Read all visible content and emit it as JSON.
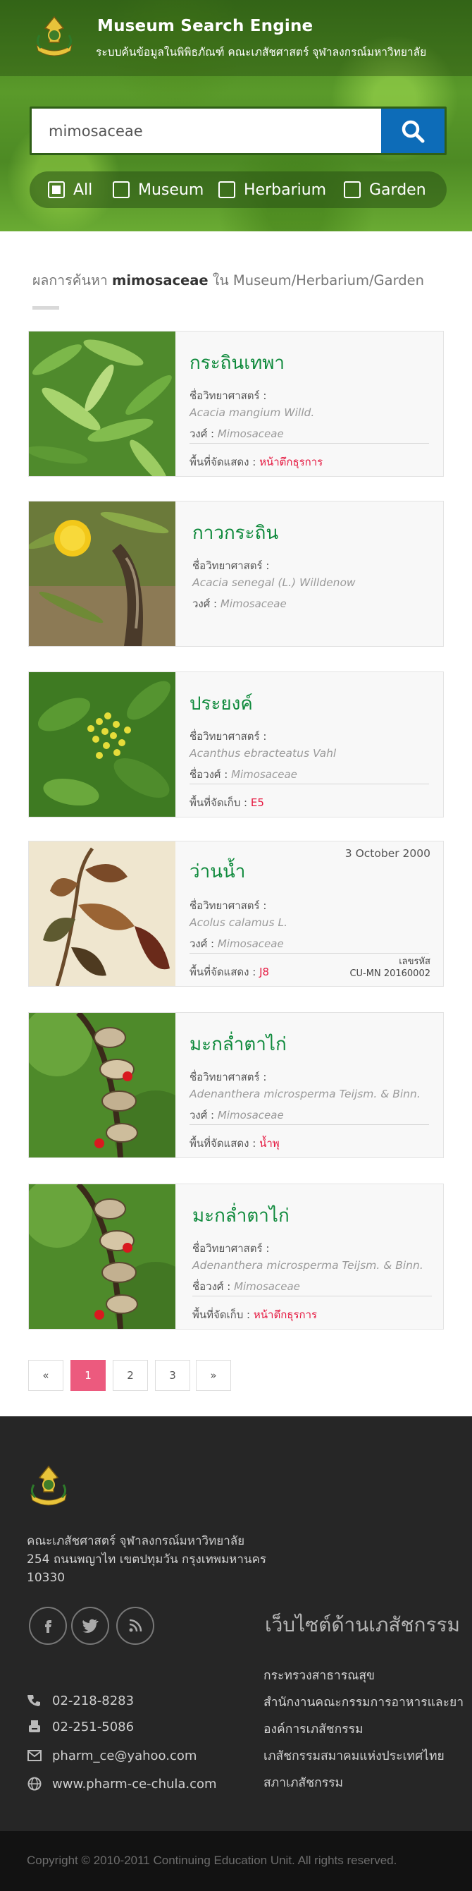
{
  "header": {
    "title": "Museum Search Engine",
    "subtitle": "ระบบค้นข้อมูลในพิพิธภัณฑ์ คณะเภสัชศาสตร์ จุฬาลงกรณ์มหาวิทยาลัย"
  },
  "search": {
    "value": "mimosaceae",
    "button_icon": "search-icon"
  },
  "filters": [
    {
      "label": "All",
      "checked": true
    },
    {
      "label": "Museum",
      "checked": false
    },
    {
      "label": "Herbarium",
      "checked": false
    },
    {
      "label": "Garden",
      "checked": false
    }
  ],
  "results_heading": {
    "prefix": "ผลการค้นหา",
    "term": "mimosaceae",
    "suffix": "ใน Museum/Herbarium/Garden"
  },
  "results": [
    {
      "name": "กระถินเทพา",
      "sci_label": "ชื่อวิทยาศาสตร์ :",
      "sci_name": "Acacia mangium Willd.",
      "family_label": "วงศ์ :",
      "family": "Mimosaceae",
      "loc_label": "พื้นที่จัดแสดง :",
      "loc": "หน้าตึกธุรการ"
    },
    {
      "name": "กาวกระถิน",
      "sci_label": "ชื่อวิทยาศาสตร์ :",
      "sci_name": "Acacia senegal  (L.) Willdenow",
      "family_label": "วงศ์ :",
      "family": "Mimosaceae"
    },
    {
      "name": "ประยงค์",
      "sci_label": "ชื่อวิทยาศาสตร์ :",
      "sci_name": "Acanthus ebracteatus Vahl",
      "family_label": "ชื่อวงศ์ :",
      "family": "Mimosaceae",
      "loc_label": "พื้นที่จัดเก็บ :",
      "loc": "E5"
    },
    {
      "name": "ว่านน้ำ",
      "date": "3 October  2000",
      "sci_label": "ชื่อวิทยาศาสตร์ :",
      "sci_name": "Acolus calamus L.",
      "family_label": "วงศ์ :",
      "family": "Mimosaceae",
      "loc_label": "พื้นที่จัดแสดง :",
      "loc": "J8",
      "code_label": "เลขรหัส",
      "code": "CU-MN 20160002"
    },
    {
      "name": "มะกล่ำตาไก่",
      "sci_label": "ชื่อวิทยาศาสตร์ :",
      "sci_name": "Adenanthera microsperma Teijsm. & Binn.",
      "family_label": "วงศ์ :",
      "family": "Mimosaceae",
      "loc_label": "พื้นที่จัดแสดง :",
      "loc": "น้ำพุ"
    },
    {
      "name": "มะกล่ำตาไก่",
      "sci_label": "ชื่อวิทยาศาสตร์ :",
      "sci_name": "Adenanthera microsperma Teijsm. & Binn.",
      "family_label": "ชื่อวงศ์ :",
      "family": "Mimosaceae",
      "loc_label": "พื้นที่จัดเก็บ :",
      "loc": "หน้าตึกธุรการ"
    }
  ],
  "pagination": {
    "prev": "«",
    "pages": [
      "1",
      "2",
      "3"
    ],
    "active": "1",
    "next": "»"
  },
  "footer": {
    "address_lines": [
      "คณะเภสัชศาสตร์ จุฬาลงกรณ์มหาวิทยาลัย",
      "254 ถนนพญาไท เขตปทุมวัน กรุงเทพมหานคร",
      "10330"
    ],
    "social": [
      "facebook-icon",
      "twitter-icon",
      "rss-icon"
    ],
    "links_heading": "เว็บไซต์ด้านเภสัชกรรม",
    "links": [
      "กระทรวงสาธารณสุข",
      "สำนักงานคณะกรรมการอาหารและยา",
      "องค์การเภสัชกรรม",
      "เภสัชกรรมสมาคมแห่งประเทศไทย",
      "สภาเภสัชกรรม"
    ],
    "contacts": [
      {
        "icon": "phone-icon",
        "text": "02-218-8283"
      },
      {
        "icon": "fax-icon",
        "text": "02-251-5086"
      },
      {
        "icon": "envelope-icon",
        "text": "pharm_ce@yahoo.com"
      },
      {
        "icon": "globe-icon",
        "text": "www.pharm-ce-chula.com"
      }
    ],
    "copyright": "Copyright © 2010-2011 Continuing Education Unit. All rights reserved."
  },
  "colors": {
    "accent_green": "#0f8a3c",
    "search_button": "#0d6cb8",
    "highlight_red": "#e5173f",
    "pager_active": "#ec5a7e",
    "footer_bg": "#262626"
  }
}
